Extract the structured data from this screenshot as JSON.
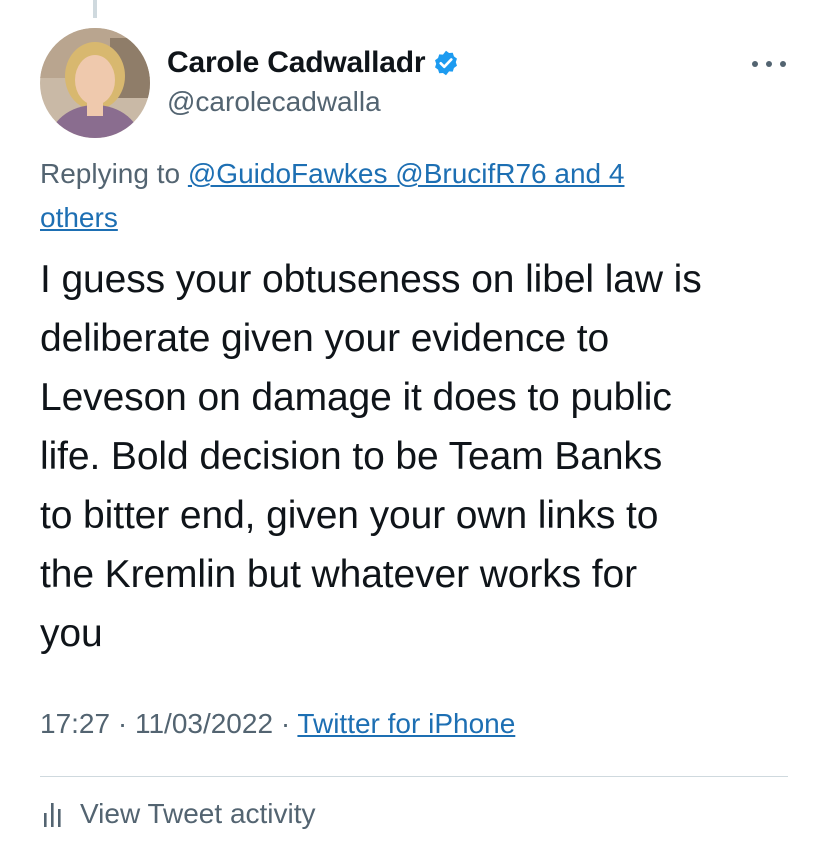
{
  "author": {
    "display_name": "Carole Cadwalladr",
    "handle": "@carolecadwalla",
    "verified": true
  },
  "reply": {
    "prefix": "Replying to",
    "mentions_line1": "@GuidoFawkes @BrucifR76 and 4",
    "mentions_line2": "others"
  },
  "tweet": {
    "lines": [
      "I guess your obtuseness on libel law is",
      "deliberate given your evidence to",
      "Leveson on damage it does to public",
      "life. Bold decision to be Team Banks",
      "to bitter end, given your own links to",
      "the Kremlin but whatever works for",
      "you"
    ]
  },
  "meta": {
    "time": "17:27",
    "separator": "·",
    "date": "11/03/2022",
    "source": "Twitter for iPhone"
  },
  "activity": {
    "label": "View Tweet activity",
    "icon": "bar-chart-icon"
  },
  "colors": {
    "link": "#1d6fb3",
    "secondary_text": "#536471",
    "verified": "#1d9bf0"
  }
}
